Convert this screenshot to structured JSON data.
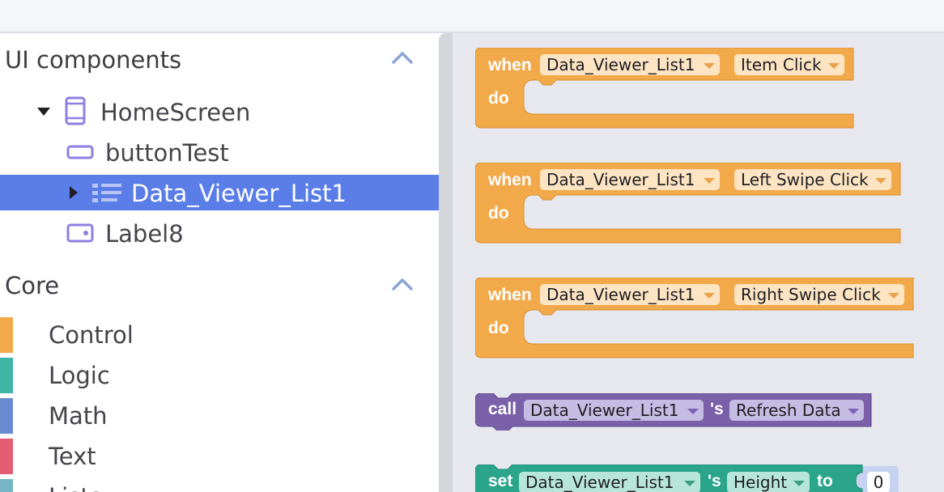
{
  "sidebar": {
    "ui_section": {
      "title": "UI components"
    },
    "tree": [
      {
        "label": "HomeScreen"
      },
      {
        "label": "buttonTest"
      },
      {
        "label": "Data_Viewer_List1"
      },
      {
        "label": "Label8"
      }
    ],
    "core_section": {
      "title": "Core"
    },
    "categories": [
      {
        "label": "Control",
        "color": "#f2a94a"
      },
      {
        "label": "Logic",
        "color": "#3fb5a5"
      },
      {
        "label": "Math",
        "color": "#6b8bd0"
      },
      {
        "label": "Text",
        "color": "#e35c73"
      },
      {
        "label": "Lists",
        "color": "#74b6c6"
      }
    ]
  },
  "workspace": {
    "keyword_when": "when",
    "keyword_do": "do",
    "keyword_call": "call",
    "keyword_possessive": "'s",
    "keyword_set": "set",
    "keyword_to": "to",
    "events": [
      {
        "component": "Data_Viewer_List1",
        "event": "Item Click"
      },
      {
        "component": "Data_Viewer_List1",
        "event": "Left Swipe Click"
      },
      {
        "component": "Data_Viewer_List1",
        "event": "Right Swipe Click"
      }
    ],
    "call_block": {
      "component": "Data_Viewer_List1",
      "method": "Refresh Data"
    },
    "set_block": {
      "component": "Data_Viewer_List1",
      "property": "Height",
      "value": "0"
    }
  },
  "colors": {
    "event_block": "#f2a94a",
    "call_block": "#7a5fa9",
    "set_block": "#2aa58a",
    "selection": "#5a7de8"
  }
}
